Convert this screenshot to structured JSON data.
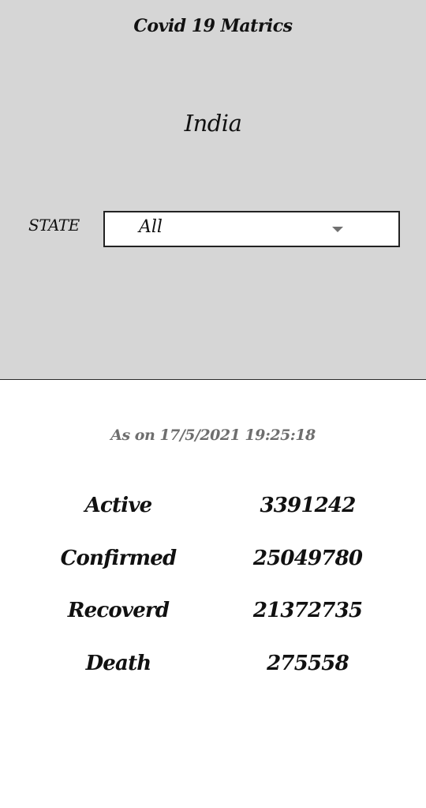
{
  "header": {
    "app_title": "Covid 19 Matrics",
    "country": "India"
  },
  "filter": {
    "label": "STATE",
    "selected": "All"
  },
  "timestamp": "As on 17/5/2021 19:25:18",
  "metrics": [
    {
      "label": "Active",
      "value": "3391242"
    },
    {
      "label": "Confirmed",
      "value": "25049780"
    },
    {
      "label": "Recoverd",
      "value": "21372735"
    },
    {
      "label": "Death",
      "value": "275558"
    }
  ],
  "colors": {
    "top_background": "#d6d6d6",
    "page_background": "#ffffff",
    "timestamp_text": "#6e6e6e",
    "caret": "#707070"
  }
}
